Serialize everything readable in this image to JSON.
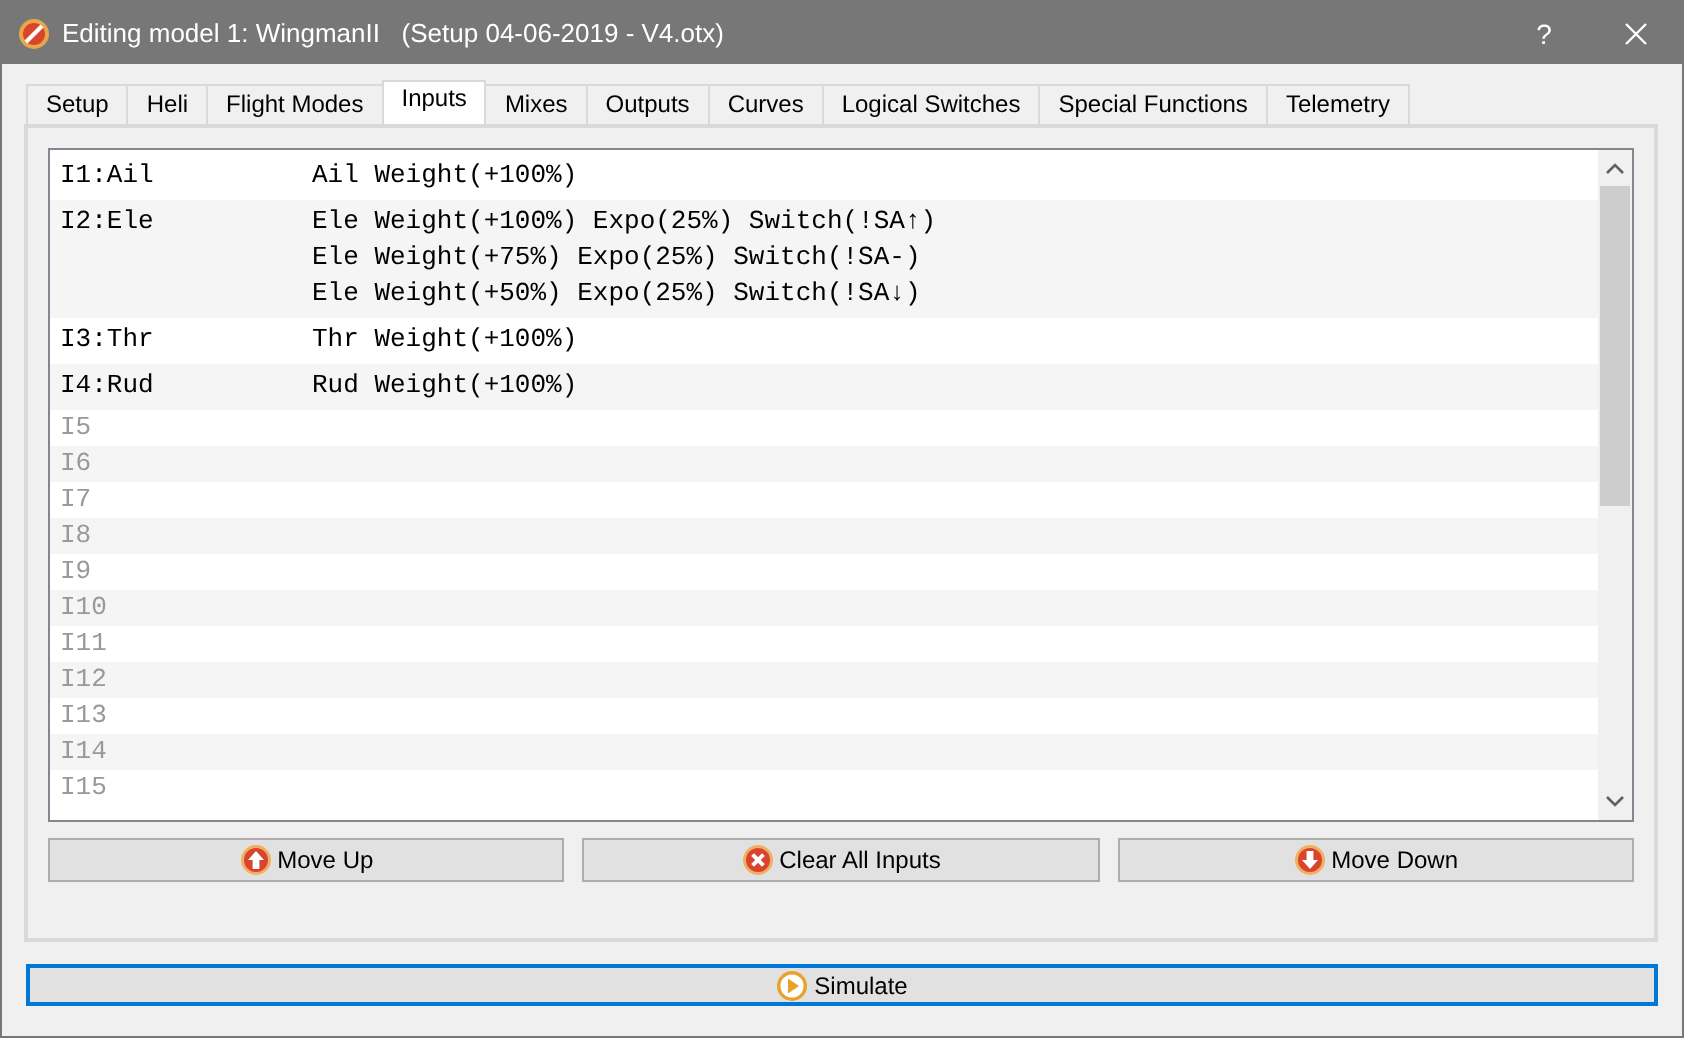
{
  "window": {
    "title": "Editing model 1: WingmanII   (Setup 04-06-2019 - V4.otx)",
    "help": "?"
  },
  "tabs": [
    {
      "label": "Setup",
      "selected": false
    },
    {
      "label": "Heli",
      "selected": false
    },
    {
      "label": "Flight Modes",
      "selected": false
    },
    {
      "label": "Inputs",
      "selected": true
    },
    {
      "label": "Mixes",
      "selected": false
    },
    {
      "label": "Outputs",
      "selected": false
    },
    {
      "label": "Curves",
      "selected": false
    },
    {
      "label": "Logical Switches",
      "selected": false
    },
    {
      "label": "Special Functions",
      "selected": false
    },
    {
      "label": "Telemetry",
      "selected": false
    }
  ],
  "inputs": [
    {
      "label": "I1:Ail",
      "kind": "defined",
      "lines": [
        "Ail Weight(+100%)"
      ]
    },
    {
      "label": "I2:Ele",
      "kind": "defined",
      "lines": [
        "Ele Weight(+100%) Expo(25%) Switch(!SA↑)",
        "Ele Weight(+75%) Expo(25%) Switch(!SA-)",
        "Ele Weight(+50%) Expo(25%) Switch(!SA↓)"
      ]
    },
    {
      "label": "I3:Thr",
      "kind": "defined",
      "lines": [
        "Thr Weight(+100%)"
      ]
    },
    {
      "label": "I4:Rud",
      "kind": "defined",
      "lines": [
        "Rud Weight(+100%)"
      ]
    },
    {
      "label": "I5",
      "kind": "empty"
    },
    {
      "label": "I6",
      "kind": "empty"
    },
    {
      "label": "I7",
      "kind": "empty"
    },
    {
      "label": "I8",
      "kind": "empty"
    },
    {
      "label": "I9",
      "kind": "empty"
    },
    {
      "label": "I10",
      "kind": "empty"
    },
    {
      "label": "I11",
      "kind": "empty"
    },
    {
      "label": "I12",
      "kind": "empty"
    },
    {
      "label": "I13",
      "kind": "empty"
    },
    {
      "label": "I14",
      "kind": "empty"
    },
    {
      "label": "I15",
      "kind": "empty"
    }
  ],
  "buttons": [
    {
      "label": "Move Up",
      "kind": "up"
    },
    {
      "label": "Clear All Inputs",
      "kind": "clear"
    },
    {
      "label": "Move Down",
      "kind": "down"
    }
  ],
  "simulate": {
    "label": "Simulate"
  }
}
